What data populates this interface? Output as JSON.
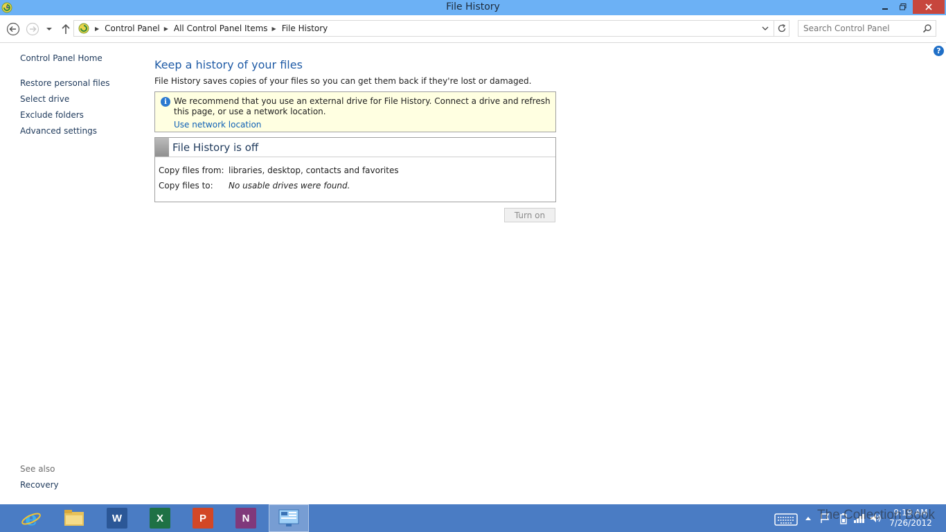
{
  "window": {
    "title": "File History"
  },
  "address": {
    "breadcrumbs": [
      "Control Panel",
      "All Control Panel Items",
      "File History"
    ]
  },
  "search": {
    "placeholder": "Search Control Panel"
  },
  "sidebar": {
    "home": "Control Panel Home",
    "items": [
      "Restore personal files",
      "Select drive",
      "Exclude folders",
      "Advanced settings"
    ],
    "see_also_label": "See also",
    "see_also_items": [
      "Recovery"
    ]
  },
  "main": {
    "title": "Keep a history of your files",
    "description": "File History saves copies of your files so you can get them back if they're lost or damaged.",
    "info": {
      "text": "We recommend that you use an external drive for File History. Connect a drive and refresh this page, or use a network location.",
      "link": "Use network location"
    },
    "status": {
      "title": "File History is off",
      "copy_from_label": "Copy files from:",
      "copy_from_value": "libraries, desktop, contacts and favorites",
      "copy_to_label": "Copy files to:",
      "copy_to_value": "No usable drives were found."
    },
    "turn_on_label": "Turn on"
  },
  "taskbar": {
    "apps": [
      "internet-explorer",
      "file-explorer",
      "word",
      "excel",
      "powerpoint",
      "onenote",
      "control-panel"
    ],
    "app_letters": {
      "word": "W",
      "excel": "X",
      "powerpoint": "P",
      "onenote": "N"
    },
    "clock_time": "9:19 AM",
    "clock_date": "7/26/2012"
  },
  "watermark": "The Collection Book",
  "colors": {
    "titlebar": "#6cb1f5",
    "taskbar": "#4a7cc4",
    "close": "#c7463d",
    "link": "#1e395b",
    "heading": "#1e5aa5",
    "info_bg": "#ffffe1"
  }
}
